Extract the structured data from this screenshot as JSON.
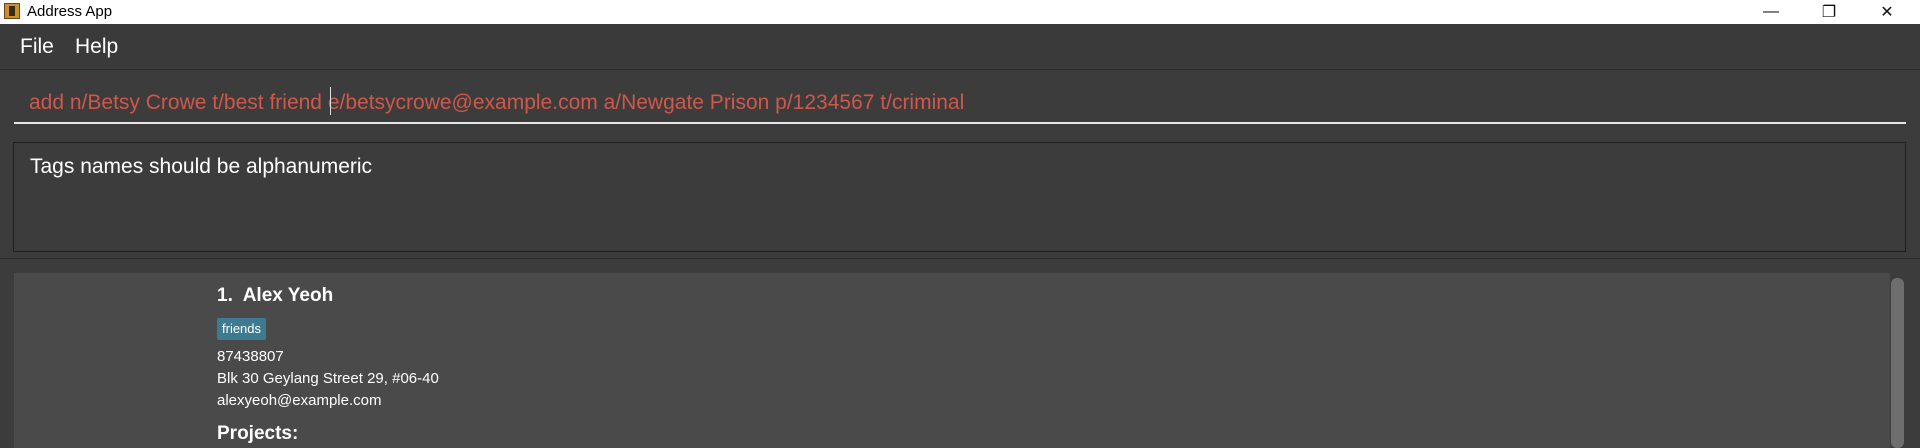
{
  "window": {
    "title": "Address App",
    "app_icon": "address-book-icon",
    "controls": {
      "minimize_glyph": "—",
      "maximize_glyph": "❐",
      "close_glyph": "✕"
    }
  },
  "menu": {
    "items": [
      {
        "label": "File"
      },
      {
        "label": "Help"
      }
    ]
  },
  "command_box": {
    "value": "add n/Betsy Crowe t/best friend e/betsycrowe@example.com a/Newgate Prison p/1234567 t/criminal",
    "text_color": "#d0574a"
  },
  "result_display": {
    "text": "Tags names should be alphanumeric"
  },
  "person_list": {
    "cards": [
      {
        "index": "1.",
        "name": "Alex Yeoh",
        "index_name": "1.  Alex Yeoh",
        "tags": [
          "friends"
        ],
        "phone": "87438807",
        "address": "Blk 30 Geylang Street 29, #06-40",
        "email": "alexyeoh@example.com",
        "projects_label": "Projects:"
      }
    ]
  },
  "colors": {
    "background": "#3c3c3c",
    "card": "#4a4a4a",
    "tag": "#3e7b91",
    "error_text": "#d0574a"
  }
}
